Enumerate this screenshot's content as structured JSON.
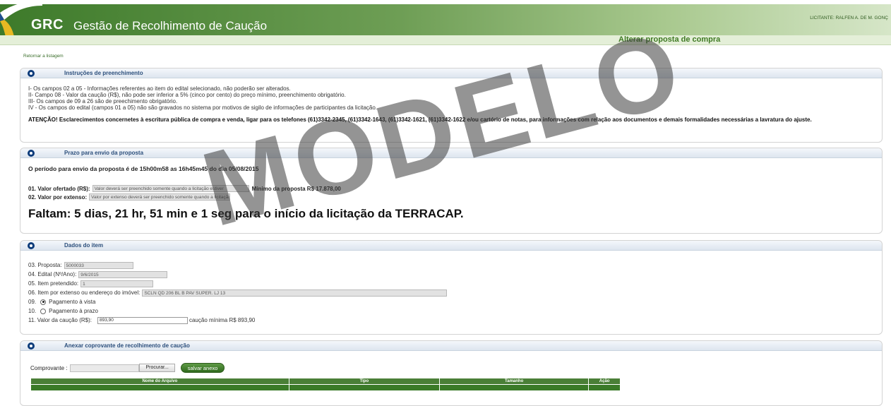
{
  "header": {
    "brand": "GRC",
    "title": "Gestão de Recolhimento de Caução",
    "user": "LICITANTE: RALFEN A. DE M. GONÇ",
    "subtitle": "Alterar proposta de compra"
  },
  "back_link": "Retornar a listagem",
  "instructions": {
    "title": "Instruções de preenchimento",
    "lines": [
      "I- Os campos 02 a 05 - Informações referentes ao item do edital selecionado, não poderão ser alterados.",
      "II- Campo 08 - Valor da caução (R$), não pode ser inferior a 5% (cinco por cento) do preço mínimo, preenchimento obrigatório.",
      "III- Os campos de 09 a 26 são de preechimento obrigatório.",
      "IV - Os campos do edital (campos 01 a 05) não são gravados no sistema por motivos de sigilo de informações de participantes da licitação."
    ],
    "warning": "ATENÇÃO! Esclarecimentos concernetes à escritura pública de compra e venda, ligar para os telefones (61)3342-2345, (61)3342-1643, (61)3342-1621, (61)3342-1622 e/ou cartório de notas, para informações com relação aos documentos e demais formalidades necessárias a lavratura do ajuste."
  },
  "deadline": {
    "title": "Prazo para envio da proposta",
    "period": "O período para envio da proposta é de 15h00m58 as 16h45m45 do dia 05/08/2015",
    "offer_label": "01. Valor ofertado (R$):",
    "offer_value": "Valor deverá ser preenchido somente quando a licitação estiver",
    "minimum": "Mínimo da proposta R$ 17.878,00",
    "extenso_label": "02. Valor por extenso:",
    "extenso_value": "Valor por extenso deverá ser preenchido somente quando a licitação i",
    "countdown": "Faltam: 5 dias, 21 hr, 51 min e 1 seg para o início da licitação da TERRACAP."
  },
  "item": {
    "title": "Dados do item",
    "proposta_label": "03. Proposta:",
    "proposta_value": "5000033",
    "edital_label": "04. Edital (Nº/Ano):",
    "edital_value": "9/6/2015",
    "item_label": "05. Item pretendido:",
    "item_value": "1",
    "endereco_label": "06. Item por extenso ou endereço do imóvel:",
    "endereco_value": "SCLN QD 206  BL B PAV SUPER. LJ 13",
    "opt9_num": "09.",
    "opt9_label": "Pagamento à vista",
    "opt10_num": "10.",
    "opt10_label": "Pagamento à prazo",
    "caucao_label": "11. Valor da caução (R$):",
    "caucao_value": "893,90",
    "caucao_min": "caução mínima R$ 893,90"
  },
  "attach": {
    "title": "Anexar coprovante de recolhimento de caução",
    "comprovante_label": "Comprovante :",
    "browse": "Procurar...",
    "save": "salvar anexo",
    "columns": [
      "Nome do Arquivo",
      "Tipo",
      "Tamanho",
      "Ação"
    ]
  },
  "watermark": "MODELO",
  "colors": {
    "header_green": "#3d7a2a",
    "subtitle_green": "#3f7a23",
    "panel_icon": "#0c3b7a",
    "table_green": "#3a7a28"
  }
}
